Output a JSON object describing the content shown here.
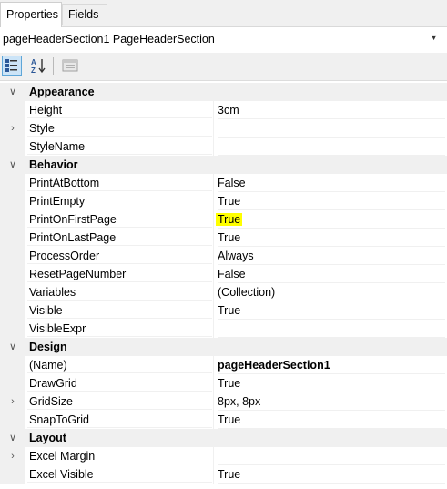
{
  "tabs": [
    {
      "label": "Properties",
      "active": true
    },
    {
      "label": "Fields",
      "active": false
    }
  ],
  "selector": {
    "text": "pageHeaderSection1  PageHeaderSection"
  },
  "toolbar": {
    "buttons": [
      "categorized-icon",
      "alphabetical-icon",
      "property-pages-icon"
    ],
    "categorized_pressed": true
  },
  "grid": {
    "categories": [
      {
        "label": "Appearance",
        "props": [
          {
            "name": "Height",
            "value": "3cm",
            "expand": false
          },
          {
            "name": "Style",
            "value": "",
            "expand": true
          },
          {
            "name": "StyleName",
            "value": "",
            "expand": false
          }
        ]
      },
      {
        "label": "Behavior",
        "props": [
          {
            "name": "PrintAtBottom",
            "value": "False",
            "expand": false
          },
          {
            "name": "PrintEmpty",
            "value": "True",
            "expand": false
          },
          {
            "name": "PrintOnFirstPage",
            "value": "True",
            "expand": false,
            "highlight": true
          },
          {
            "name": "PrintOnLastPage",
            "value": "True",
            "expand": false
          },
          {
            "name": "ProcessOrder",
            "value": "Always",
            "expand": false
          },
          {
            "name": "ResetPageNumber",
            "value": "False",
            "expand": false
          },
          {
            "name": "Variables",
            "value": "(Collection)",
            "expand": false
          },
          {
            "name": "Visible",
            "value": "True",
            "expand": false
          },
          {
            "name": "VisibleExpr",
            "value": "",
            "expand": false
          }
        ]
      },
      {
        "label": "Design",
        "props": [
          {
            "name": "(Name)",
            "value": "pageHeaderSection1",
            "expand": false,
            "bold": true
          },
          {
            "name": "DrawGrid",
            "value": "True",
            "expand": false
          },
          {
            "name": "GridSize",
            "value": "8px, 8px",
            "expand": true
          },
          {
            "name": "SnapToGrid",
            "value": "True",
            "expand": false
          }
        ]
      },
      {
        "label": "Layout",
        "props": [
          {
            "name": "Excel Margin",
            "value": "",
            "expand": true
          },
          {
            "name": "Excel Visible",
            "value": "True",
            "expand": false
          }
        ]
      }
    ]
  },
  "colors": {
    "highlight": "#ffff00",
    "pressed_bg": "#cce4f7",
    "pressed_border": "#5ea6d8",
    "gutter": "#f0f0f0"
  }
}
